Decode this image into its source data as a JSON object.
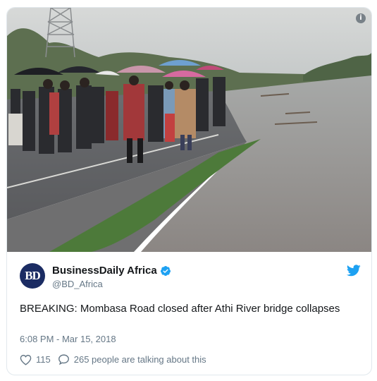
{
  "media": {
    "info_glyph": "i",
    "photo_subject": "people-with-umbrellas-beside-flooded-road"
  },
  "account": {
    "avatar_text": "BD",
    "display_name": "BusinessDaily Africa",
    "handle": "@BD_Africa",
    "verified": true
  },
  "tweet": {
    "text": "BREAKING: Mombasa Road closed after Athi River bridge collapses",
    "timestamp": "6:08 PM - Mar 15, 2018"
  },
  "actions": {
    "likes": "115",
    "replies_text": "265 people are talking about this"
  },
  "colors": {
    "twitter_blue": "#1da1f2",
    "avatar_bg": "#1b2c63",
    "secondary_text": "#657786",
    "border": "#e1e8ed"
  }
}
